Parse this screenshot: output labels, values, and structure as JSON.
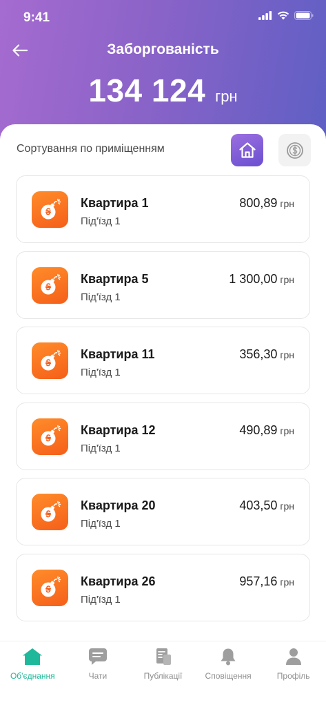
{
  "status": {
    "time": "9:41"
  },
  "header": {
    "title": "Заборгованість",
    "total_amount": "134 124",
    "total_currency": "грн"
  },
  "sort": {
    "label": "Сортування по приміщенням"
  },
  "apartments": [
    {
      "name": "Квартира 1",
      "entrance": "Під'їзд 1",
      "amount": "800,89",
      "currency": "грн"
    },
    {
      "name": "Квартира 5",
      "entrance": "Під'їзд 1",
      "amount": "1 300,00",
      "currency": "грн"
    },
    {
      "name": "Квартира 11",
      "entrance": "Під'їзд 1",
      "amount": "356,30",
      "currency": "грн"
    },
    {
      "name": "Квартира 12",
      "entrance": "Під'їзд 1",
      "amount": "490,89",
      "currency": "грн"
    },
    {
      "name": "Квартира 20",
      "entrance": "Під'їзд 1",
      "amount": "403,50",
      "currency": "грн"
    },
    {
      "name": "Квартира 26",
      "entrance": "Під'їзд 1",
      "amount": "957,16",
      "currency": "грн"
    }
  ],
  "tabs": [
    {
      "label": "Об'єднання",
      "icon": "home-icon",
      "active": true
    },
    {
      "label": "Чати",
      "icon": "chat-icon",
      "active": false
    },
    {
      "label": "Публікації",
      "icon": "publications-icon",
      "active": false
    },
    {
      "label": "Сповіщення",
      "icon": "bell-icon",
      "active": false
    },
    {
      "label": "Профіль",
      "icon": "profile-icon",
      "active": false
    }
  ],
  "colors": {
    "header_start": "#a56bd0",
    "header_end": "#5e5fc4",
    "accent_orange": "#f55f1a",
    "active_tab": "#1fb89a"
  }
}
